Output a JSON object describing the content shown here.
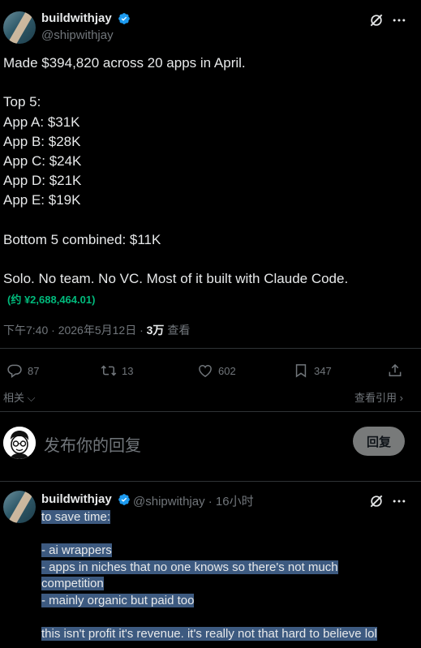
{
  "post": {
    "display_name": "buildwithjay",
    "handle": "@shipwithjay",
    "body": "Made $394,820 across 20 apps in April.\n\nTop 5:\nApp A: $31K\nApp B: $28K\nApp C: $24K\nApp D: $21K\nApp E: $19K\n\nBottom 5 combined: $11K\n\nSolo. No team. No VC. Most of it built with Claude Code.",
    "translation": "(约 ¥2,688,464.01)",
    "time": "下午7:40 · 2026年5月12日 · ",
    "views_count": "3万",
    "views_label": " 查看",
    "icons": [
      "grok-icon",
      "more-icon"
    ]
  },
  "actions": {
    "replies": "87",
    "reposts": "13",
    "likes": "602",
    "bookmarks": "347"
  },
  "related_label": "相关",
  "view_quotes_label": "查看引用",
  "composer": {
    "placeholder": "发布你的回复",
    "button_label": "回复"
  },
  "reply": {
    "display_name": "buildwithjay",
    "handle_time": "@shipwithjay · 16小时",
    "lines": [
      "to save time:",
      "",
      "- ai wrappers",
      "- apps in niches that no one knows so there's not much",
      "competition",
      "- mainly organic but paid too",
      "",
      "this isn't profit it's revenue. it's really not that hard to believe lol"
    ]
  },
  "colors": {
    "background": "#000000",
    "text": "#e7e9ea",
    "secondary": "#71767b",
    "verified": "#1d9bf0",
    "translation": "#00ba7c",
    "selection": "#3d5a80"
  }
}
